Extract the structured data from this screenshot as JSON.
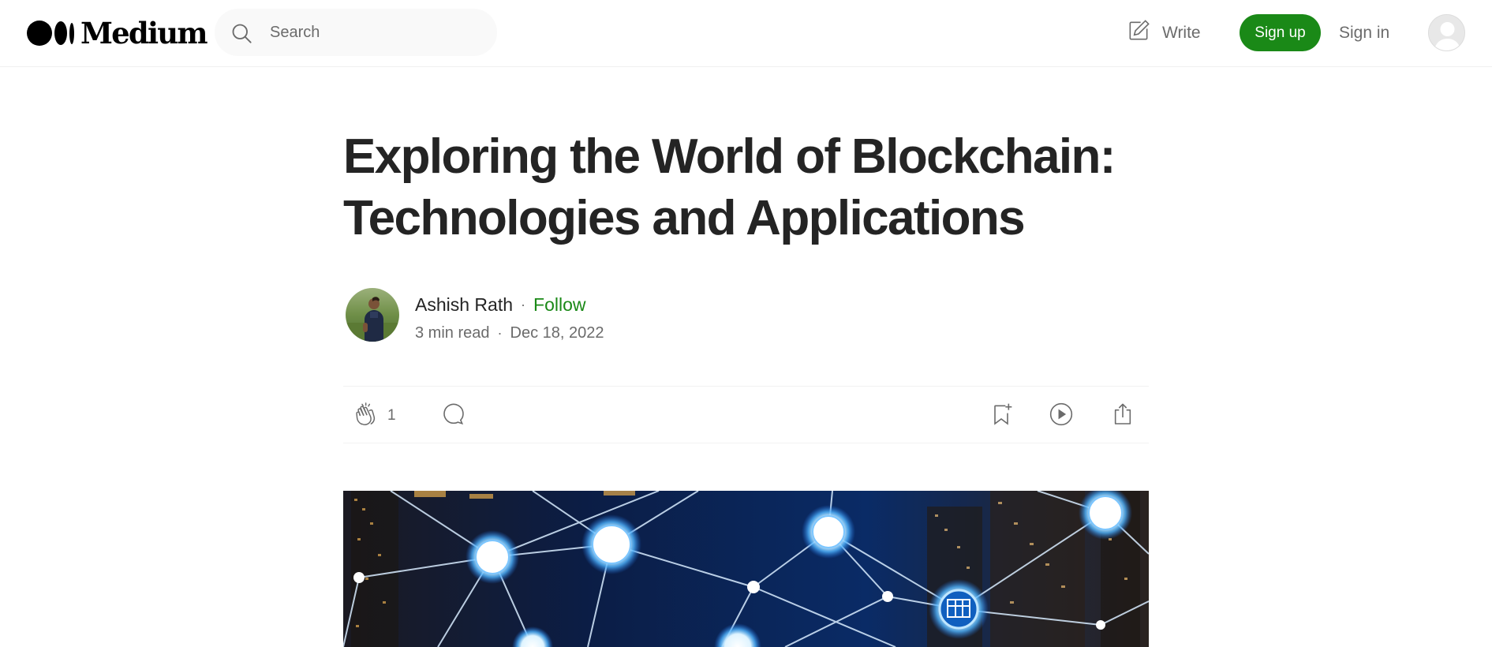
{
  "header": {
    "logo_text": "Medium",
    "search": {
      "placeholder": "Search",
      "value": ""
    },
    "write_label": "Write",
    "signup_label": "Sign up",
    "signin_label": "Sign in",
    "accent_color": "#1a8917"
  },
  "article": {
    "title": "Exploring the World of Blockchain: Technologies and Applications",
    "author": {
      "name": "Ashish Rath",
      "follow_label": "Follow"
    },
    "read_time": "3 min read",
    "date": "Dec 18, 2022",
    "claps": "1"
  },
  "icons": {
    "search": "search-icon",
    "write": "write-icon",
    "clap": "clap-icon",
    "respond": "comment-icon",
    "save": "bookmark-add-icon",
    "listen": "play-icon",
    "share": "share-icon"
  }
}
